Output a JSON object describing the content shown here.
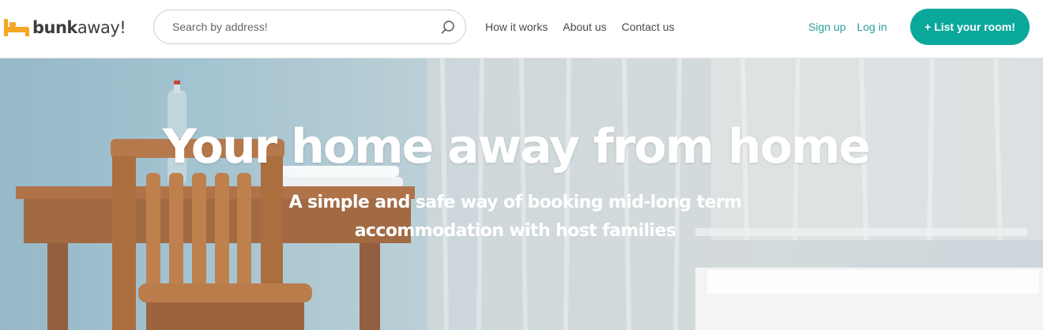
{
  "brand": {
    "name_bold": "bunk",
    "name_light": "away!",
    "logo_icon": "bed-icon",
    "icon_color": "#f5a623"
  },
  "search": {
    "placeholder": "Search by address!",
    "value": "",
    "icon": "search-icon"
  },
  "nav": {
    "items": [
      {
        "label": "How it works"
      },
      {
        "label": "About us"
      },
      {
        "label": "Contact us"
      }
    ]
  },
  "auth": {
    "signup_label": "Sign up",
    "login_label": "Log in"
  },
  "cta": {
    "label": "+ List your room!"
  },
  "hero": {
    "title": "Your home away from home",
    "subtitle_line1": "A simple and safe way of booking mid-long term",
    "subtitle_line2": "accommodation with host families"
  },
  "colors": {
    "accent": "#0aa89b",
    "link": "#2aa198",
    "nav_text": "#4a4a4a"
  }
}
